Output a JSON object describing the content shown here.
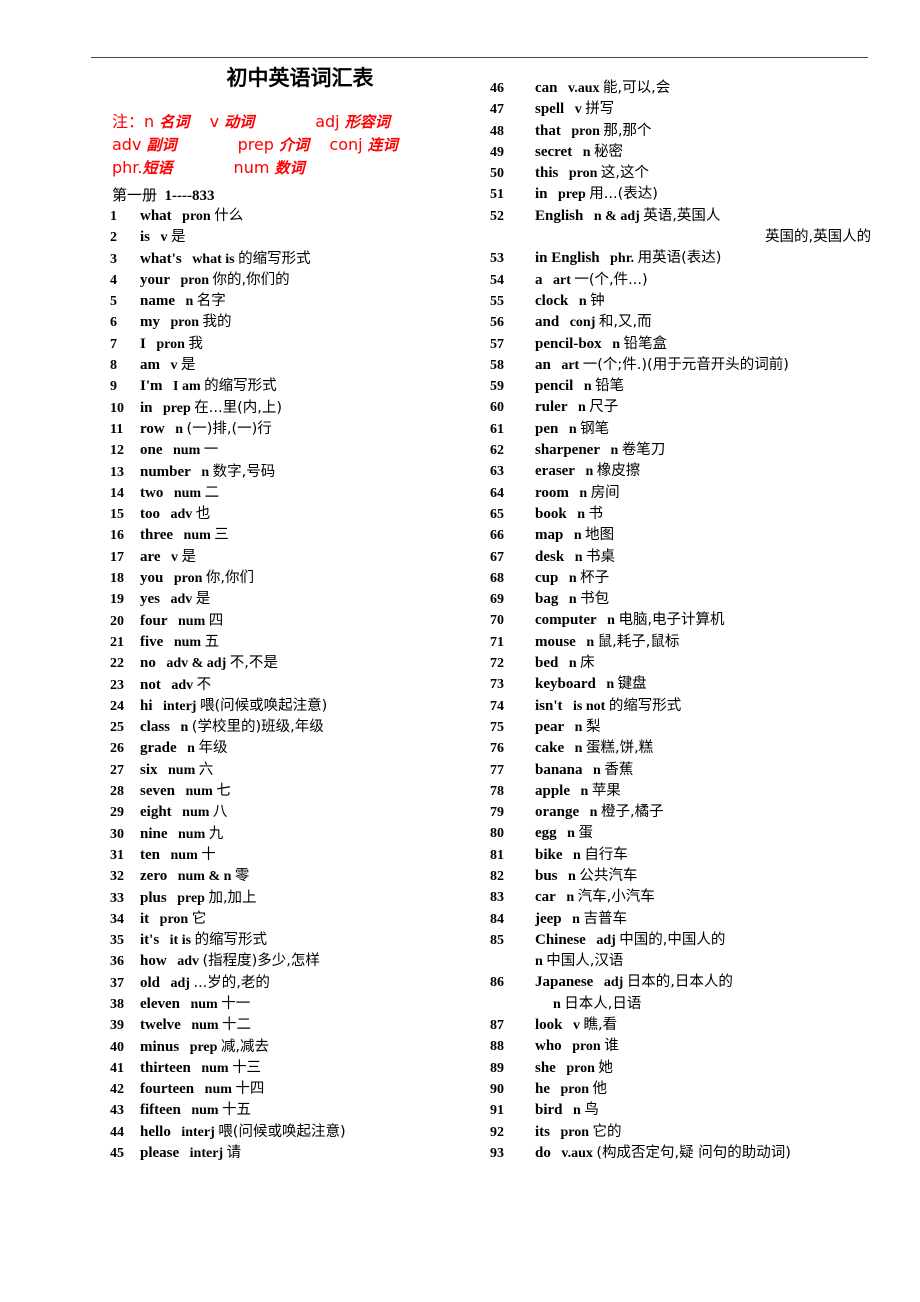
{
  "document": {
    "title": "初中英语词汇表",
    "legend": [
      "注：n 名词    v 动词            adj 形容词",
      "adv 副词            prep 介词    conj 连词",
      "phr.短语            num 数词"
    ],
    "volume_heading": "第一册  1----833"
  },
  "columns": {
    "left": [
      {
        "num": "1",
        "word": "what",
        "pos": "pron",
        "cn": "什么"
      },
      {
        "num": "2",
        "word": "is",
        "pos": "v",
        "cn": "是"
      },
      {
        "num": "3",
        "word": "what's",
        "pos": "what is",
        "cn": "的缩写形式"
      },
      {
        "num": "4",
        "word": "your",
        "pos": "pron",
        "cn": "你的,你们的"
      },
      {
        "num": "5",
        "word": "name",
        "pos": "n",
        "cn": "名字"
      },
      {
        "num": "6",
        "word": "my",
        "pos": "pron",
        "cn": "我的"
      },
      {
        "num": "7",
        "word": "I",
        "pos": "pron",
        "cn": "我"
      },
      {
        "num": "8",
        "word": "am",
        "pos": "v",
        "cn": "是"
      },
      {
        "num": "9",
        "word": "I'm",
        "pos": "I am",
        "cn": "的缩写形式"
      },
      {
        "num": "10",
        "word": "in",
        "pos": "prep",
        "cn": "在...里(内,上)"
      },
      {
        "num": "11",
        "word": "row",
        "pos": "n",
        "cn": "(一)排,(一)行"
      },
      {
        "num": "12",
        "word": "one",
        "pos": "num",
        "cn": "一"
      },
      {
        "num": "13",
        "word": "number",
        "pos": "n",
        "cn": "数字,号码"
      },
      {
        "num": "14",
        "word": "two",
        "pos": "num",
        "cn": "二"
      },
      {
        "num": "15",
        "word": "too",
        "pos": "adv",
        "cn": "也"
      },
      {
        "num": "16",
        "word": "three",
        "pos": "num",
        "cn": "三"
      },
      {
        "num": "17",
        "word": "are",
        "pos": "v",
        "cn": "是"
      },
      {
        "num": "18",
        "word": "you",
        "pos": "pron",
        "cn": "你,你们"
      },
      {
        "num": "19",
        "word": "yes",
        "pos": "adv",
        "cn": "是"
      },
      {
        "num": "20",
        "word": "four",
        "pos": "num",
        "cn": "四"
      },
      {
        "num": "21",
        "word": "five",
        "pos": "num",
        "cn": "五"
      },
      {
        "num": "22",
        "word": "no",
        "pos": "adv & adj",
        "cn": "不,不是"
      },
      {
        "num": "23",
        "word": "not",
        "pos": "adv",
        "cn": "不"
      },
      {
        "num": "24",
        "word": "hi",
        "pos": "interj",
        "cn": "喂(问候或唤起注意)"
      },
      {
        "num": "25",
        "word": "class",
        "pos": "n",
        "cn": "(学校里的)班级,年级"
      },
      {
        "num": "26",
        "word": "grade",
        "pos": "n",
        "cn": "年级"
      },
      {
        "num": "27",
        "word": "six",
        "pos": "num",
        "cn": "六"
      },
      {
        "num": "28",
        "word": "seven",
        "pos": "num",
        "cn": "七"
      },
      {
        "num": "29",
        "word": "eight",
        "pos": "num",
        "cn": "八"
      },
      {
        "num": "30",
        "word": "nine",
        "pos": "num",
        "cn": "九"
      },
      {
        "num": "31",
        "word": "ten",
        "pos": "num",
        "cn": "十"
      },
      {
        "num": "32",
        "word": "zero",
        "pos": "num & n",
        "cn": "零"
      },
      {
        "num": "33",
        "word": "plus",
        "pos": "prep",
        "cn": "加,加上"
      },
      {
        "num": "34",
        "word": "it",
        "pos": "pron",
        "cn": "它"
      },
      {
        "num": "35",
        "word": "it's",
        "pos": "it is",
        "cn": "的缩写形式"
      },
      {
        "num": "36",
        "word": "how",
        "pos": "adv",
        "cn": "(指程度)多少,怎样"
      },
      {
        "num": "37",
        "word": "old",
        "pos": "adj",
        "cn": "...岁的,老的"
      },
      {
        "num": "38",
        "word": "eleven",
        "pos": "num",
        "cn": "十一"
      },
      {
        "num": "39",
        "word": "twelve",
        "pos": "num",
        "cn": "十二"
      },
      {
        "num": "40",
        "word": "minus",
        "pos": "prep",
        "cn": "减,减去"
      },
      {
        "num": "41",
        "word": "thirteen",
        "pos": "num",
        "cn": "十三"
      },
      {
        "num": "42",
        "word": "fourteen",
        "pos": "num",
        "cn": "十四"
      },
      {
        "num": "43",
        "word": "fifteen",
        "pos": "num",
        "cn": "十五"
      },
      {
        "num": "44",
        "word": "hello",
        "pos": "interj",
        "cn": "喂(问候或唤起注意)"
      },
      {
        "num": "45",
        "word": "please",
        "pos": "interj",
        "cn": "请"
      }
    ],
    "right": [
      {
        "num": "46",
        "word": "can",
        "pos": "v.aux",
        "cn": "能,可以,会"
      },
      {
        "num": "47",
        "word": "spell",
        "pos": "v",
        "cn": "拼写"
      },
      {
        "num": "48",
        "word": "that",
        "pos": "pron",
        "cn": "那,那个"
      },
      {
        "num": "49",
        "word": "secret",
        "pos": "n",
        "cn": "秘密"
      },
      {
        "num": "50",
        "word": "this",
        "pos": "pron",
        "cn": "这,这个"
      },
      {
        "num": "51",
        "word": "in",
        "pos": "prep",
        "cn": "用...(表达)"
      },
      {
        "num": "52",
        "word": "English",
        "pos": "n & adj",
        "cn": "英语,英国人"
      },
      {
        "num": "",
        "word": "",
        "pos": "",
        "cn": "英国的,英国人的",
        "indent": 230
      },
      {
        "num": "53",
        "word": "in English",
        "pos": "phr.",
        "cn": "用英语(表达)"
      },
      {
        "num": "54",
        "word": "a",
        "pos": "art",
        "cn": "一(个,件...)"
      },
      {
        "num": "55",
        "word": "clock",
        "pos": "n",
        "cn": "钟"
      },
      {
        "num": "56",
        "word": "and",
        "pos": "conj",
        "cn": "和,又,而"
      },
      {
        "num": "57",
        "word": "pencil-box",
        "pos": "n",
        "cn": "铅笔盒"
      },
      {
        "num": "58",
        "word": "an",
        "pos": "art",
        "cn": "一(个;件.)(用于元音开头的词前)"
      },
      {
        "num": "59",
        "word": "pencil",
        "pos": "n",
        "cn": "铅笔"
      },
      {
        "num": "60",
        "word": "ruler",
        "pos": "n",
        "cn": "尺子"
      },
      {
        "num": "61",
        "word": "pen",
        "pos": "n",
        "cn": "钢笔"
      },
      {
        "num": "62",
        "word": "sharpener",
        "pos": "n",
        "cn": "卷笔刀"
      },
      {
        "num": "63",
        "word": "eraser",
        "pos": "n",
        "cn": "橡皮擦"
      },
      {
        "num": "64",
        "word": "room",
        "pos": "n",
        "cn": "房间"
      },
      {
        "num": "65",
        "word": "book",
        "pos": "n",
        "cn": "书"
      },
      {
        "num": "66",
        "word": "map",
        "pos": "n",
        "cn": "地图"
      },
      {
        "num": "67",
        "word": "desk",
        "pos": "n",
        "cn": "书桌"
      },
      {
        "num": "68",
        "word": "cup",
        "pos": "n",
        "cn": "杯子"
      },
      {
        "num": "69",
        "word": "bag",
        "pos": "n",
        "cn": "书包"
      },
      {
        "num": "70",
        "word": "computer",
        "pos": "n",
        "cn": "电脑,电子计算机"
      },
      {
        "num": "71",
        "word": "mouse",
        "pos": "n",
        "cn": "鼠,耗子,鼠标"
      },
      {
        "num": "72",
        "word": "bed",
        "pos": "n",
        "cn": "床"
      },
      {
        "num": "73",
        "word": "keyboard",
        "pos": "n",
        "cn": "键盘"
      },
      {
        "num": "74",
        "word": "isn't",
        "pos": "is not",
        "cn": "的缩写形式"
      },
      {
        "num": "75",
        "word": "pear",
        "pos": "n",
        "cn": "梨"
      },
      {
        "num": "76",
        "word": "cake",
        "pos": "n",
        "cn": "蛋糕,饼,糕"
      },
      {
        "num": "77",
        "word": "banana",
        "pos": "n",
        "cn": "香蕉"
      },
      {
        "num": "78",
        "word": "apple",
        "pos": "n",
        "cn": "苹果"
      },
      {
        "num": "79",
        "word": "orange",
        "pos": "n",
        "cn": "橙子,橘子"
      },
      {
        "num": "80",
        "word": "egg",
        "pos": "n",
        "cn": "蛋"
      },
      {
        "num": "81",
        "word": "bike",
        "pos": "n",
        "cn": "自行车"
      },
      {
        "num": "82",
        "word": "bus",
        "pos": "n",
        "cn": "公共汽车"
      },
      {
        "num": "83",
        "word": "car",
        "pos": "n",
        "cn": "汽车,小汽车"
      },
      {
        "num": "84",
        "word": "jeep",
        "pos": "n",
        "cn": "吉普车"
      },
      {
        "num": "85",
        "word": "Chinese",
        "pos": "adj",
        "cn": "中国的,中国人的"
      },
      {
        "num": "",
        "word": "",
        "pos": "n",
        "cn": "中国人,汉语",
        "indent": 0
      },
      {
        "num": "86",
        "word": "Japanese",
        "pos": "adj",
        "cn": "日本的,日本人的"
      },
      {
        "num": "",
        "word": "",
        "pos": "n",
        "cn": "日本人,日语",
        "indent": 18
      },
      {
        "num": "87",
        "word": "look",
        "pos": "v",
        "cn": "瞧,看"
      },
      {
        "num": "88",
        "word": "who",
        "pos": "pron",
        "cn": "谁"
      },
      {
        "num": "89",
        "word": "she",
        "pos": "pron",
        "cn": "她"
      },
      {
        "num": "90",
        "word": "he",
        "pos": "pron",
        "cn": "他"
      },
      {
        "num": "91",
        "word": "bird",
        "pos": "n",
        "cn": "鸟"
      },
      {
        "num": "92",
        "word": "its",
        "pos": "pron",
        "cn": "它的"
      },
      {
        "num": "93",
        "word": "do",
        "pos": "v.aux",
        "cn": "(构成否定句,疑 问句的助动词)"
      }
    ]
  },
  "style": {
    "rule_color": "#4d4450",
    "legend_color": "#FF0000",
    "text_color": "#000000"
  }
}
